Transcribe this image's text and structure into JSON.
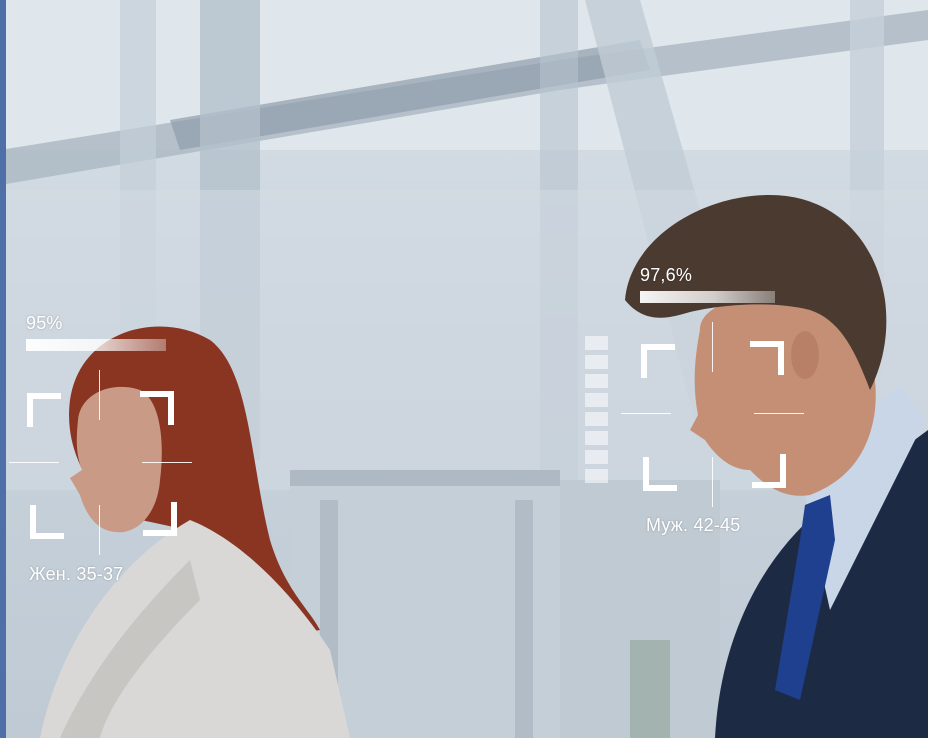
{
  "faces": [
    {
      "confidence": "95%",
      "demographic": "Жен. 35-37"
    },
    {
      "confidence": "97,6%",
      "demographic": "Муж. 42-45"
    }
  ],
  "colors": {
    "accent_edge": "#4f6fa8",
    "overlay": "#ffffff",
    "suit": "#1d2a44",
    "tie": "#1f3f8f"
  }
}
